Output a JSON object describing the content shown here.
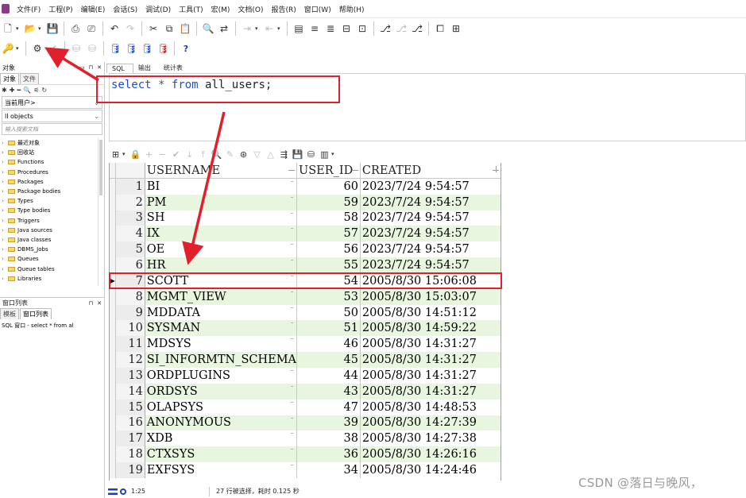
{
  "menu": {
    "items": [
      "文件(F)",
      "工程(P)",
      "编辑(E)",
      "会话(S)",
      "调试(D)",
      "工具(T)",
      "宏(M)",
      "文档(O)",
      "报告(R)",
      "窗口(W)",
      "帮助(H)"
    ]
  },
  "left_panel": {
    "objects_title": "对象",
    "tabs": [
      "对象",
      "文件"
    ],
    "user_combo": "当前用户>",
    "filter_combo": "ll objects",
    "search_placeholder": "输入搜索文档",
    "tree_items": [
      "最近对象",
      "回收站",
      "Functions",
      "Procedures",
      "Packages",
      "Package bodies",
      "Types",
      "Type bodies",
      "Triggers",
      "Java sources",
      "Java classes",
      "DBMS_Jobs",
      "Queues",
      "Queue tables",
      "Libraries"
    ],
    "window_list_title": "窗口列表",
    "window_tabs": [
      "模板",
      "窗口列表"
    ],
    "window_entry": "SQL 窗口 - select * from al"
  },
  "editor": {
    "tabs": [
      "SQL",
      "输出",
      "统计表"
    ],
    "sql": {
      "kw_select": "select",
      "star": "*",
      "kw_from": "from",
      "table": "all_users",
      "semicolon": ";"
    }
  },
  "grid": {
    "columns": [
      "USERNAME",
      "USER_ID",
      "CREATED"
    ],
    "rows": [
      {
        "n": "1",
        "username": "BI",
        "user_id": "60",
        "created": "2023/7/24 9:54:57"
      },
      {
        "n": "2",
        "username": "PM",
        "user_id": "59",
        "created": "2023/7/24 9:54:57"
      },
      {
        "n": "3",
        "username": "SH",
        "user_id": "58",
        "created": "2023/7/24 9:54:57"
      },
      {
        "n": "4",
        "username": "IX",
        "user_id": "57",
        "created": "2023/7/24 9:54:57"
      },
      {
        "n": "5",
        "username": "OE",
        "user_id": "56",
        "created": "2023/7/24 9:54:57"
      },
      {
        "n": "6",
        "username": "HR",
        "user_id": "55",
        "created": "2023/7/24 9:54:57"
      },
      {
        "n": "7",
        "username": "SCOTT",
        "user_id": "54",
        "created": "2005/8/30 15:06:08",
        "current": true
      },
      {
        "n": "8",
        "username": "MGMT_VIEW",
        "user_id": "53",
        "created": "2005/8/30 15:03:07"
      },
      {
        "n": "9",
        "username": "MDDATA",
        "user_id": "50",
        "created": "2005/8/30 14:51:12"
      },
      {
        "n": "10",
        "username": "SYSMAN",
        "user_id": "51",
        "created": "2005/8/30 14:59:22"
      },
      {
        "n": "11",
        "username": "MDSYS",
        "user_id": "46",
        "created": "2005/8/30 14:31:27"
      },
      {
        "n": "12",
        "username": "SI_INFORMTN_SCHEMA",
        "user_id": "45",
        "created": "2005/8/30 14:31:27"
      },
      {
        "n": "13",
        "username": "ORDPLUGINS",
        "user_id": "44",
        "created": "2005/8/30 14:31:27"
      },
      {
        "n": "14",
        "username": "ORDSYS",
        "user_id": "43",
        "created": "2005/8/30 14:31:27"
      },
      {
        "n": "15",
        "username": "OLAPSYS",
        "user_id": "47",
        "created": "2005/8/30 14:48:53"
      },
      {
        "n": "16",
        "username": "ANONYMOUS",
        "user_id": "39",
        "created": "2005/8/30 14:27:39"
      },
      {
        "n": "17",
        "username": "XDB",
        "user_id": "38",
        "created": "2005/8/30 14:27:38"
      },
      {
        "n": "18",
        "username": "CTXSYS",
        "user_id": "36",
        "created": "2005/8/30 14:26:16"
      },
      {
        "n": "19",
        "username": "EXFSYS",
        "user_id": "34",
        "created": "2005/8/30 14:24:46"
      }
    ]
  },
  "status": {
    "position": "1:25",
    "message": "27 行被选择，耗时 0.125 秒"
  },
  "watermark": "CSDN @落日与晚风，",
  "colors": {
    "grid_alt_row": "#e8f5df",
    "annotation_red": "#e0202a",
    "sql_keyword": "#1f4fbf"
  }
}
